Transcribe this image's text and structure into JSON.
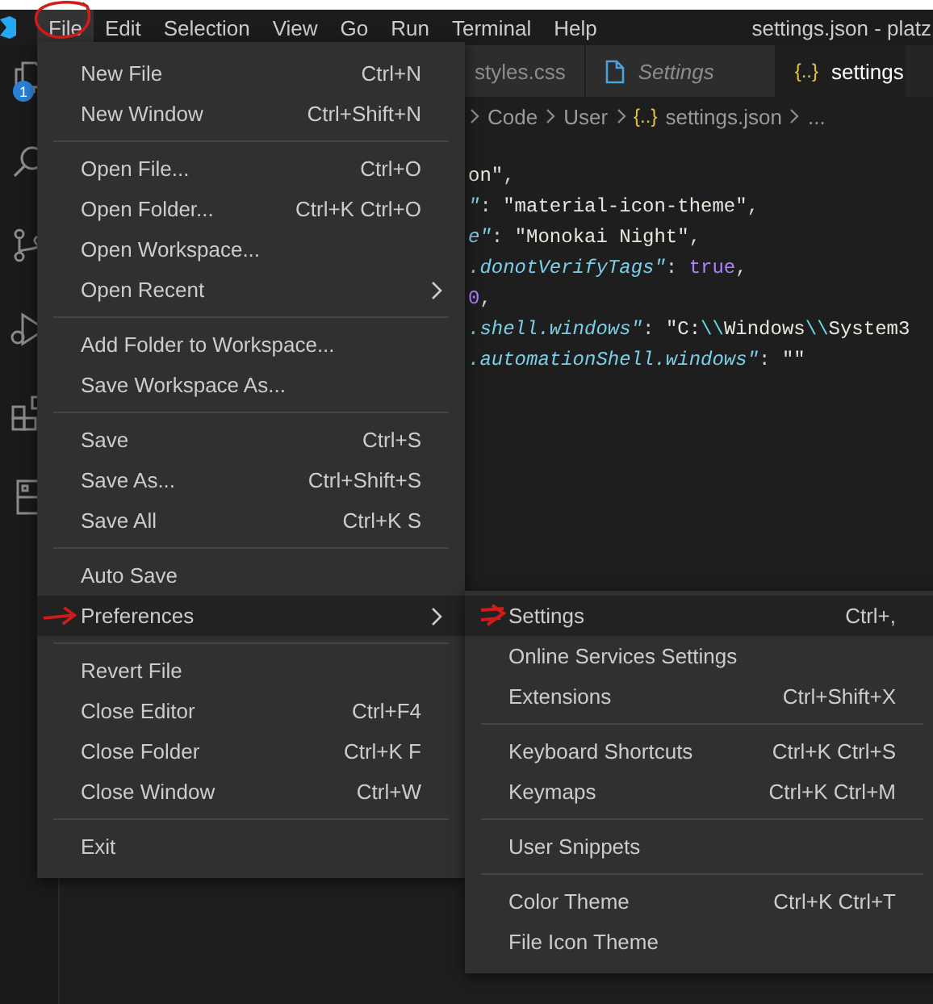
{
  "window": {
    "title": "settings.json - platz"
  },
  "menubar": [
    {
      "label": "File",
      "selected": true
    },
    {
      "label": "Edit",
      "selected": false
    },
    {
      "label": "Selection",
      "selected": false
    },
    {
      "label": "View",
      "selected": false
    },
    {
      "label": "Go",
      "selected": false
    },
    {
      "label": "Run",
      "selected": false
    },
    {
      "label": "Terminal",
      "selected": false
    },
    {
      "label": "Help",
      "selected": false
    }
  ],
  "activity_bar": {
    "badge": "1"
  },
  "tabs": [
    {
      "label": "styles.css",
      "kind": "plain",
      "preview": false,
      "selected": false
    },
    {
      "label": "Settings",
      "kind": "file",
      "preview": true,
      "selected": false
    },
    {
      "label": "settings",
      "kind": "json",
      "glyph": "{..}",
      "preview": false,
      "selected": true
    }
  ],
  "breadcrumb": [
    {
      "label": "Code",
      "kind": "plain"
    },
    {
      "label": "User",
      "kind": "plain"
    },
    {
      "label": "settings.json",
      "kind": "json",
      "glyph": "{..}"
    },
    {
      "label": "...",
      "kind": "plain"
    }
  ],
  "code_lines": [
    [
      {
        "kind": "str",
        "text": "on\""
      },
      {
        "kind": "punct",
        "text": ","
      }
    ],
    [
      {
        "kind": "key",
        "text": "\""
      },
      {
        "kind": "punct",
        "text": ": "
      },
      {
        "kind": "str",
        "text": "\"material-icon-theme\""
      },
      {
        "kind": "punct",
        "text": ","
      }
    ],
    [
      {
        "kind": "key",
        "text": "e\""
      },
      {
        "kind": "punct",
        "text": ": "
      },
      {
        "kind": "str",
        "text": "\"Monokai Night\""
      },
      {
        "kind": "punct",
        "text": ","
      }
    ],
    [
      {
        "kind": "key",
        "text": ".donotVerifyTags\""
      },
      {
        "kind": "punct",
        "text": ": "
      },
      {
        "kind": "bool",
        "text": "true"
      },
      {
        "kind": "punct",
        "text": ","
      }
    ],
    [
      {
        "kind": "num",
        "text": "0"
      },
      {
        "kind": "punct",
        "text": ","
      }
    ],
    [
      {
        "kind": "key",
        "text": ".shell.windows\""
      },
      {
        "kind": "punct",
        "text": ": "
      },
      {
        "kind": "str",
        "text": "\"C:"
      },
      {
        "kind": "esc",
        "text": "\\\\"
      },
      {
        "kind": "str",
        "text": "Windows"
      },
      {
        "kind": "esc",
        "text": "\\\\"
      },
      {
        "kind": "str",
        "text": "System3"
      }
    ],
    [
      {
        "kind": "key",
        "text": ".automationShell.windows\""
      },
      {
        "kind": "punct",
        "text": ": "
      },
      {
        "kind": "str",
        "text": "\"\""
      }
    ]
  ],
  "file_menu": [
    {
      "kind": "item",
      "label": "New File",
      "shortcut": "Ctrl+N",
      "submenu": false,
      "selected": false
    },
    {
      "kind": "item",
      "label": "New Window",
      "shortcut": "Ctrl+Shift+N",
      "submenu": false,
      "selected": false
    },
    {
      "kind": "separator"
    },
    {
      "kind": "item",
      "label": "Open File...",
      "shortcut": "Ctrl+O",
      "submenu": false,
      "selected": false
    },
    {
      "kind": "item",
      "label": "Open Folder...",
      "shortcut": "Ctrl+K Ctrl+O",
      "submenu": false,
      "selected": false
    },
    {
      "kind": "item",
      "label": "Open Workspace...",
      "submenu": false,
      "selected": false
    },
    {
      "kind": "item",
      "label": "Open Recent",
      "submenu": true,
      "selected": false
    },
    {
      "kind": "separator"
    },
    {
      "kind": "item",
      "label": "Add Folder to Workspace...",
      "submenu": false,
      "selected": false
    },
    {
      "kind": "item",
      "label": "Save Workspace As...",
      "submenu": false,
      "selected": false
    },
    {
      "kind": "separator"
    },
    {
      "kind": "item",
      "label": "Save",
      "shortcut": "Ctrl+S",
      "submenu": false,
      "selected": false
    },
    {
      "kind": "item",
      "label": "Save As...",
      "shortcut": "Ctrl+Shift+S",
      "submenu": false,
      "selected": false
    },
    {
      "kind": "item",
      "label": "Save All",
      "shortcut": "Ctrl+K S",
      "submenu": false,
      "selected": false
    },
    {
      "kind": "separator"
    },
    {
      "kind": "item",
      "label": "Auto Save",
      "submenu": false,
      "selected": false
    },
    {
      "kind": "item",
      "label": "Preferences",
      "submenu": true,
      "selected": true
    },
    {
      "kind": "separator"
    },
    {
      "kind": "item",
      "label": "Revert File",
      "submenu": false,
      "selected": false
    },
    {
      "kind": "item",
      "label": "Close Editor",
      "shortcut": "Ctrl+F4",
      "submenu": false,
      "selected": false
    },
    {
      "kind": "item",
      "label": "Close Folder",
      "shortcut": "Ctrl+K F",
      "submenu": false,
      "selected": false
    },
    {
      "kind": "item",
      "label": "Close Window",
      "shortcut": "Ctrl+W",
      "submenu": false,
      "selected": false
    },
    {
      "kind": "separator"
    },
    {
      "kind": "item",
      "label": "Exit",
      "submenu": false,
      "selected": false
    }
  ],
  "preferences_menu": [
    {
      "kind": "item",
      "label": "Settings",
      "shortcut": "Ctrl+,",
      "submenu": false,
      "selected": true
    },
    {
      "kind": "item",
      "label": "Online Services Settings",
      "submenu": false,
      "selected": false
    },
    {
      "kind": "item",
      "label": "Extensions",
      "shortcut": "Ctrl+Shift+X",
      "submenu": false,
      "selected": false
    },
    {
      "kind": "separator"
    },
    {
      "kind": "item",
      "label": "Keyboard Shortcuts",
      "shortcut": "Ctrl+K Ctrl+S",
      "submenu": false,
      "selected": false
    },
    {
      "kind": "item",
      "label": "Keymaps",
      "shortcut": "Ctrl+K Ctrl+M",
      "submenu": false,
      "selected": false
    },
    {
      "kind": "separator"
    },
    {
      "kind": "item",
      "label": "User Snippets",
      "submenu": false,
      "selected": false
    },
    {
      "kind": "separator"
    },
    {
      "kind": "item",
      "label": "Color Theme",
      "shortcut": "Ctrl+K Ctrl+T",
      "submenu": false,
      "selected": false
    },
    {
      "kind": "item",
      "label": "File Icon Theme",
      "submenu": false,
      "selected": false
    }
  ]
}
